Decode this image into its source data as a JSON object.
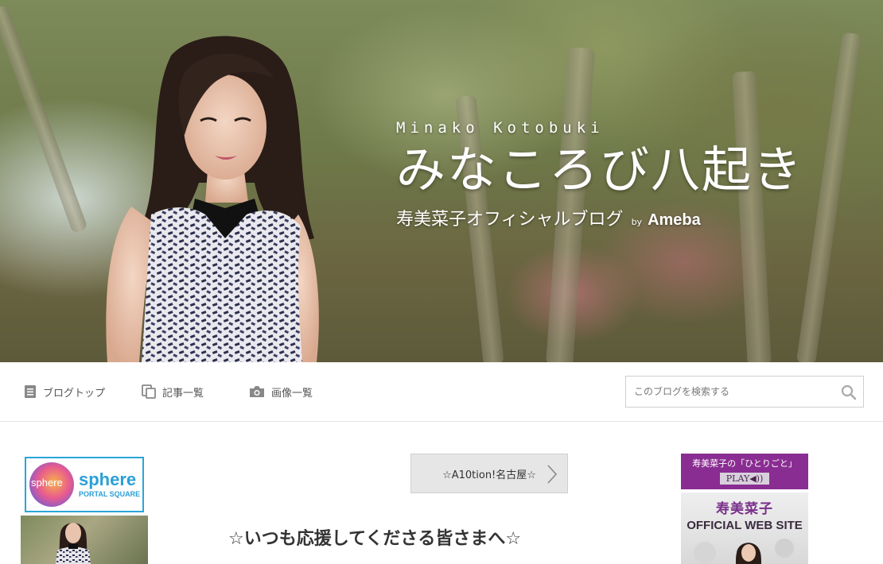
{
  "header": {
    "name_en": "Minako Kotobuki",
    "title": "みなころび八起き",
    "subtitle": "寿美菜子オフィシャルブログ",
    "by": "by",
    "ameba": "Ameba"
  },
  "nav": {
    "items": [
      {
        "label": "ブログトップ",
        "icon": "document-icon"
      },
      {
        "label": "記事一覧",
        "icon": "copy-icon"
      },
      {
        "label": "画像一覧",
        "icon": "camera-icon"
      }
    ],
    "search": {
      "placeholder": "このブログを検索する",
      "value": ""
    }
  },
  "left_sidebar": {
    "sphere_logo_text": "sphere",
    "sphere_word": "sphere",
    "sphere_sub": "PORTAL SQUARE"
  },
  "main": {
    "next_article_label": "☆A10tion!名古屋☆",
    "post_title": "☆いつも応援してくださる皆さまへ☆"
  },
  "right_sidebar": {
    "hitorigoto_title": "寿美菜子の「ひとりごと」",
    "hitorigoto_play": "PLAY◀))",
    "official_name": "寿美菜子",
    "official_label": "OFFICIAL WEB SITE"
  },
  "colors": {
    "accent_purple": "#8a2d92",
    "sphere_blue": "#29a6d9"
  }
}
